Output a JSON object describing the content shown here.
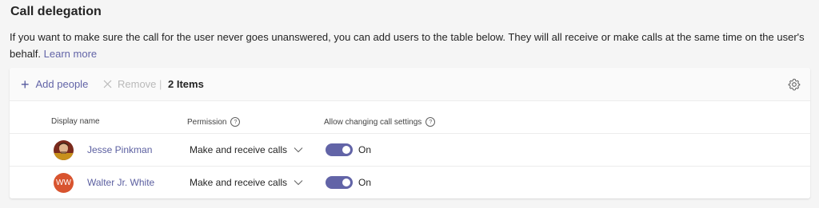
{
  "section": {
    "title": "Call delegation",
    "description": "If you want to make sure the call for the user never goes unanswered, you can add users to the table below. They will all receive or make calls at the same time on the user's behalf. ",
    "learn_more": "Learn more"
  },
  "toolbar": {
    "add_label": "Add people",
    "remove_label": "Remove",
    "separator": "|",
    "item_count": "2 Items"
  },
  "table": {
    "columns": {
      "display_name": "Display name",
      "permission": "Permission",
      "allow_changing": "Allow changing call settings"
    },
    "rows": [
      {
        "name": "Jesse Pinkman",
        "permission": "Make and receive calls",
        "toggle_label": "On",
        "toggle_on": true,
        "avatar": "photo"
      },
      {
        "name": "Walter Jr. White",
        "permission": "Make and receive calls",
        "toggle_label": "On",
        "toggle_on": true,
        "avatar": "initials",
        "initials": "WW",
        "avatar_color": "#d8542f"
      }
    ]
  },
  "colors": {
    "accent": "#6264a7",
    "background": "#f5f5f5",
    "card": "#ffffff"
  },
  "icons": [
    "plus-icon",
    "close-icon",
    "gear-icon",
    "info-icon",
    "chevron-down-icon"
  ]
}
